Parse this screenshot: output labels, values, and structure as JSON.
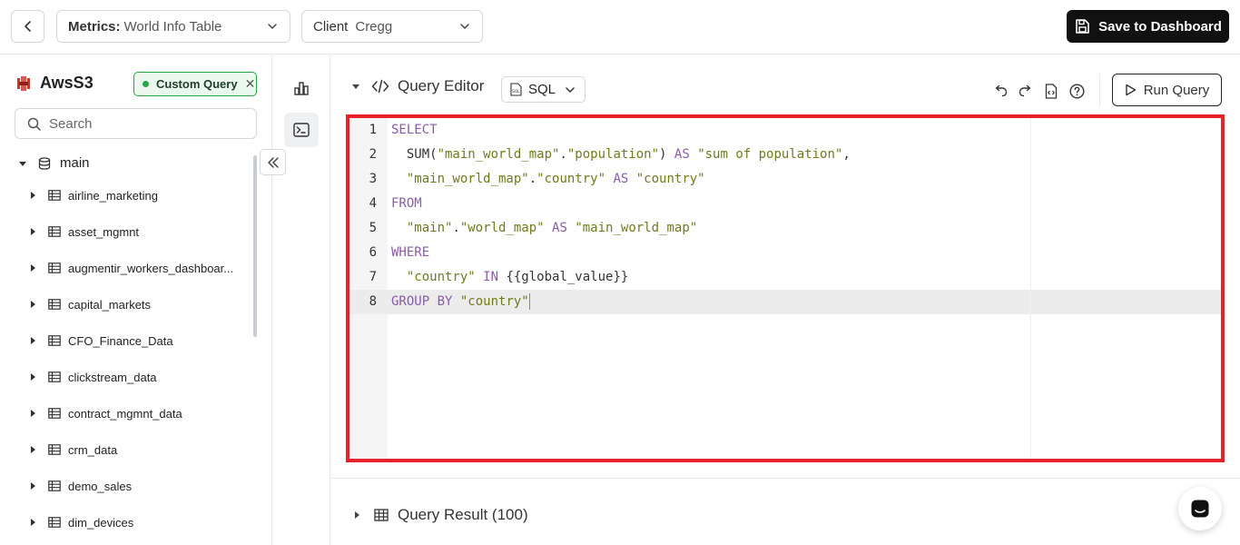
{
  "topbar": {
    "metrics_label": "Metrics:",
    "metrics_value": "World Info Table",
    "client_label": "Client",
    "client_value": "Cregg",
    "save_label": "Save to Dashboard"
  },
  "sidebar": {
    "source_title": "AwsS3",
    "badge_label": "Custom Query",
    "search_placeholder": "Search",
    "root_label": "main",
    "items": [
      {
        "label": "airline_marketing"
      },
      {
        "label": "asset_mgmnt"
      },
      {
        "label": "augmentir_workers_dashboar..."
      },
      {
        "label": "capital_markets"
      },
      {
        "label": "CFO_Finance_Data"
      },
      {
        "label": "clickstream_data"
      },
      {
        "label": "contract_mgmnt_data"
      },
      {
        "label": "crm_data"
      },
      {
        "label": "demo_sales"
      },
      {
        "label": "dim_devices"
      }
    ]
  },
  "editor": {
    "title": "Query Editor",
    "language": "SQL",
    "run_label": "Run Query",
    "active_line": 8,
    "lines": [
      {
        "n": "1",
        "text": "SELECT"
      },
      {
        "n": "2",
        "text": "  SUM(\"main_world_map\".\"population\") AS \"sum of population\","
      },
      {
        "n": "3",
        "text": "  \"main_world_map\".\"country\" AS \"country\""
      },
      {
        "n": "4",
        "text": "FROM"
      },
      {
        "n": "5",
        "text": "  \"main\".\"world_map\" AS \"main_world_map\""
      },
      {
        "n": "6",
        "text": "WHERE"
      },
      {
        "n": "7",
        "text": "  \"country\" IN {{global_value}}"
      },
      {
        "n": "8",
        "text": "GROUP BY \"country\""
      }
    ]
  },
  "result": {
    "title": "Query Result (100)"
  },
  "colors": {
    "highlight_border": "#e8222a",
    "keyword": "#8a5ca8",
    "string": "#6f7b1a",
    "badge_green": "#27a844"
  }
}
